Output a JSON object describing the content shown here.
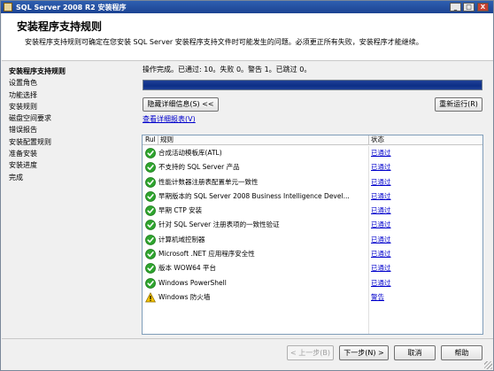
{
  "window": {
    "title": "SQL Server 2008 R2 安装程序",
    "minimize_glyph": "_",
    "maximize_glyph": "□",
    "close_glyph": "X"
  },
  "header": {
    "title": "安装程序支持规则",
    "description": "安装程序支持规则可确定在您安装 SQL Server 安装程序支持文件时可能发生的问题。必须更正所有失败，安装程序才能继续。"
  },
  "nav": {
    "items": [
      {
        "label": "安装程序支持规则",
        "active": true
      },
      {
        "label": "设置角色",
        "active": false
      },
      {
        "label": "功能选择",
        "active": false
      },
      {
        "label": "安装规则",
        "active": false
      },
      {
        "label": "磁盘空间要求",
        "active": false
      },
      {
        "label": "错误报告",
        "active": false
      },
      {
        "label": "安装配置规则",
        "active": false
      },
      {
        "label": "准备安装",
        "active": false
      },
      {
        "label": "安装进度",
        "active": false
      },
      {
        "label": "完成",
        "active": false
      }
    ]
  },
  "status": {
    "text": "操作完成。已通过: 10。失败 0。警告 1。已跳过 0。",
    "progress": 1.0
  },
  "buttons": {
    "hide_details": "隐藏详细信息(S) <<",
    "rerun": "重新运行(R)",
    "view_report": "查看详细报表(V)",
    "back": "< 上一步(B)",
    "next": "下一步(N) >",
    "cancel": "取消",
    "help": "帮助"
  },
  "table": {
    "columns": {
      "result": "Rul",
      "rule": "规则",
      "status": "状态"
    },
    "rows": [
      {
        "rule": "合成活动模板库(ATL)",
        "status": "已通过",
        "result": "pass"
      },
      {
        "rule": "不支持的 SQL Server 产品",
        "status": "已通过",
        "result": "pass"
      },
      {
        "rule": "性能计数器注册表配置单元一致性",
        "status": "已通过",
        "result": "pass"
      },
      {
        "rule": "早期版本的 SQL Server 2008 Business Intelligence Devel...",
        "status": "已通过",
        "result": "pass"
      },
      {
        "rule": "早期 CTP 安装",
        "status": "已通过",
        "result": "pass"
      },
      {
        "rule": "针对 SQL Server 注册表项的一致性验证",
        "status": "已通过",
        "result": "pass"
      },
      {
        "rule": "计算机域控制器",
        "status": "已通过",
        "result": "pass"
      },
      {
        "rule": "Microsoft .NET 应用程序安全性",
        "status": "已通过",
        "result": "pass"
      },
      {
        "rule": "版本 WOW64 平台",
        "status": "已通过",
        "result": "pass"
      },
      {
        "rule": "Windows PowerShell",
        "status": "已通过",
        "result": "pass"
      },
      {
        "rule": "Windows 防火墙",
        "status": "警告",
        "result": "warning"
      }
    ]
  },
  "icons": {
    "pass": "green-check-icon",
    "warning": "yellow-warning-icon"
  },
  "colors": {
    "titlebar": "#1c4393",
    "progress_fill": "#0c2f86",
    "link": "#0000cc",
    "pass": "#2fa52f",
    "warning": "#f2c200"
  }
}
